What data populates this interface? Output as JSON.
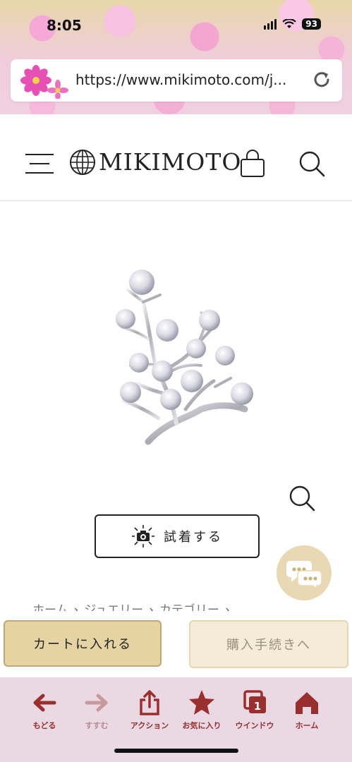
{
  "status_bar": {
    "time": "8:05",
    "battery": "93"
  },
  "address_bar": {
    "url": "https://www.mikimoto.com/j..."
  },
  "header": {
    "brand": "MIKIMOTO"
  },
  "product": {
    "try_on_label": "試着する"
  },
  "breadcrumb": [
    "ホーム",
    "ジュエリー",
    "カテゴリー"
  ],
  "actions": {
    "cart_label": "カートに入れる",
    "checkout_label": "購入手続きへ"
  },
  "toolbar": {
    "back": "もどる",
    "forward": "すすむ",
    "action": "アクション",
    "favorites": "お気に入り",
    "window": "ウインドウ",
    "window_count": "1",
    "home": "ホーム"
  },
  "colors": {
    "accent_gold": "#e6d3a3",
    "toolbar_bg": "#ead9e2",
    "toolbar_icon": "#9a2f2f"
  }
}
